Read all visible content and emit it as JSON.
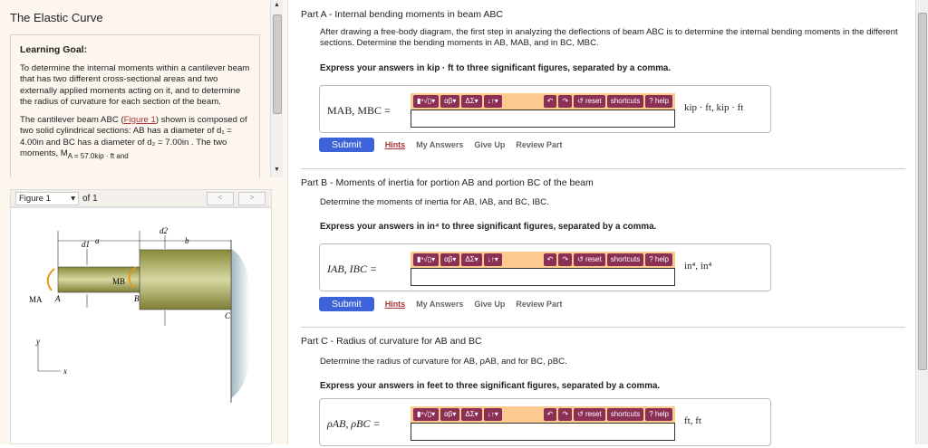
{
  "left": {
    "title": "The Elastic Curve",
    "goal_heading": "Learning Goal:",
    "goal_text": "To determine the internal moments within a cantilever beam that has two different cross-sectional areas and two externally applied moments acting on it, and to determine the radius of curvature for each section of the beam.",
    "p2_a": "The cantilever beam ABC (",
    "p2_link": "Figure 1",
    "p2_b": ") shown is composed of two solid cylindrical sections: AB has a diameter of d₁ = 4.00in and BC has a diameter of d₂ = 7.00in . The two moments, M",
    "p2_c": "A = 57.0kip · ft and",
    "figure_select": "Figure 1",
    "figure_of": "of 1",
    "fig_labels": {
      "a": "a",
      "b": "b",
      "d1": "d1",
      "d2": "d2",
      "MA": "MA",
      "MB": "MB",
      "A": "A",
      "B": "B",
      "C": "C",
      "x": "x",
      "y": "y"
    }
  },
  "parts": [
    {
      "title": "Part A - Internal bending moments in beam ABC",
      "desc": "After drawing a free-body diagram, the first step in analyzing the deflections of beam ABC is to determine the internal bending moments in the different sections. Determine the bending moments in AB, MAB, and in BC, MBC.",
      "instr": "Express your answers in kip · ft to three significant figures, separated by a comma.",
      "label": "MAB, MBC =",
      "unit": "kip · ft, kip · ft"
    },
    {
      "title": "Part B - Moments of inertia for portion AB and portion BC of the beam",
      "desc": "Determine the moments of inertia for AB, IAB, and BC, IBC.",
      "instr": "Express your answers in in⁴ to three significant figures, separated by a comma.",
      "label": "IAB, IBC =",
      "unit": "in⁴, in⁴"
    },
    {
      "title": "Part C - Radius of curvature for AB and BC",
      "desc": "Determine the radius of curvature for AB, ρAB, and for BC, ρBC.",
      "instr": "Express your answers in feet to three significant figures, separated by a comma.",
      "label": "ρAB, ρBC =",
      "unit": "ft, ft"
    }
  ],
  "toolbar": {
    "templates": "▮ⁿ√▯▾",
    "greek": "αβ▾",
    "symbols": "ΔΣ▾",
    "arrows": "↓↑▾",
    "undo": "↶",
    "redo": "↷",
    "reset": "↺ reset",
    "shortcuts": "shortcuts",
    "help": "? help"
  },
  "actions": {
    "submit": "Submit",
    "hints": "Hints",
    "my_answers": "My Answers",
    "give_up": "Give Up",
    "review": "Review Part"
  }
}
